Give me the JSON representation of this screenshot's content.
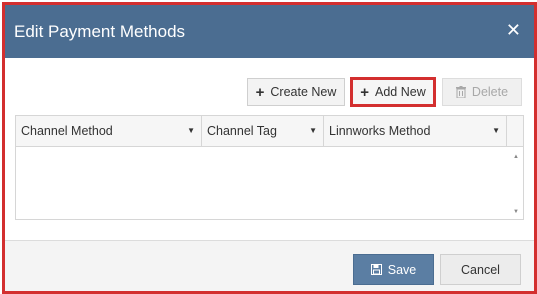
{
  "dialog": {
    "title": "Edit Payment Methods",
    "close_glyph": "✕"
  },
  "toolbar": {
    "create_new_label": "Create New",
    "add_new_label": "Add New",
    "delete_label": "Delete"
  },
  "grid": {
    "columns": [
      {
        "label": "Channel Method"
      },
      {
        "label": "Channel Tag"
      },
      {
        "label": "Linnworks Method"
      }
    ],
    "rows": []
  },
  "footer": {
    "save_label": "Save",
    "cancel_label": "Cancel"
  },
  "colors": {
    "header": "#4b6d91",
    "save_button": "#5b7ea3",
    "highlight_border": "#d32f2f"
  }
}
